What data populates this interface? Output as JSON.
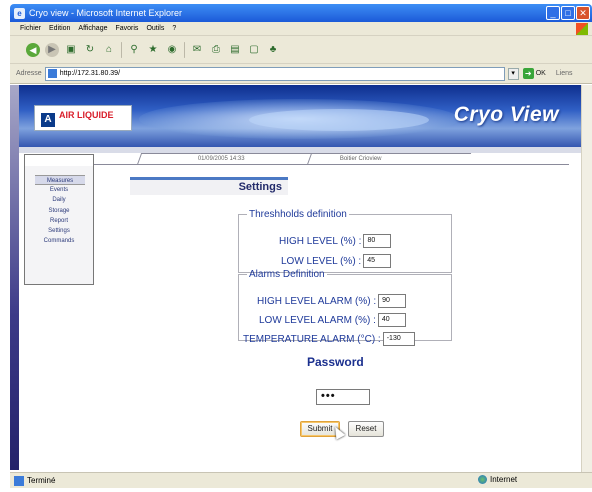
{
  "browser": {
    "title": "Cryo view - Microsoft Internet Explorer",
    "menu": [
      "Fichier",
      "Edition",
      "Affichage",
      "Favoris",
      "Outils",
      "?"
    ],
    "address_label": "Adresse",
    "url": "http://172.31.80.39/",
    "go_label": "OK",
    "links_label": "Liens",
    "status_text": "Terminé",
    "zone_text": "Internet"
  },
  "banner": {
    "logo_text": "AIR LIQUIDE",
    "title": "Cryo View"
  },
  "header": {
    "datetime": "01/09/2005 14:33",
    "site": "Boitier   Crioview"
  },
  "sidebar": {
    "items": [
      "Measures",
      "Events",
      "Daily",
      "Storage",
      "Report",
      "Settings",
      "Commands"
    ],
    "active": "Measures"
  },
  "settings": {
    "title": "Settings",
    "thresholds": {
      "legend": "Threshholds definition",
      "high_label": "HIGH LEVEL  (%) :",
      "high_value": "80",
      "low_label": "LOW LEVEL  (%) :",
      "low_value": "45"
    },
    "alarms": {
      "legend": "Alarms Definition",
      "high_label": "HIGH LEVEL ALARM  (%) :",
      "high_value": "90",
      "low_label": "LOW LEVEL ALARM  (%) :",
      "low_value": "40",
      "temp_label": "TEMPERATURE ALARM (°C) :",
      "temp_value": "-130"
    },
    "password_title": "Password",
    "password_mask": "•••",
    "submit_label": "Submit",
    "reset_label": "Reset"
  }
}
